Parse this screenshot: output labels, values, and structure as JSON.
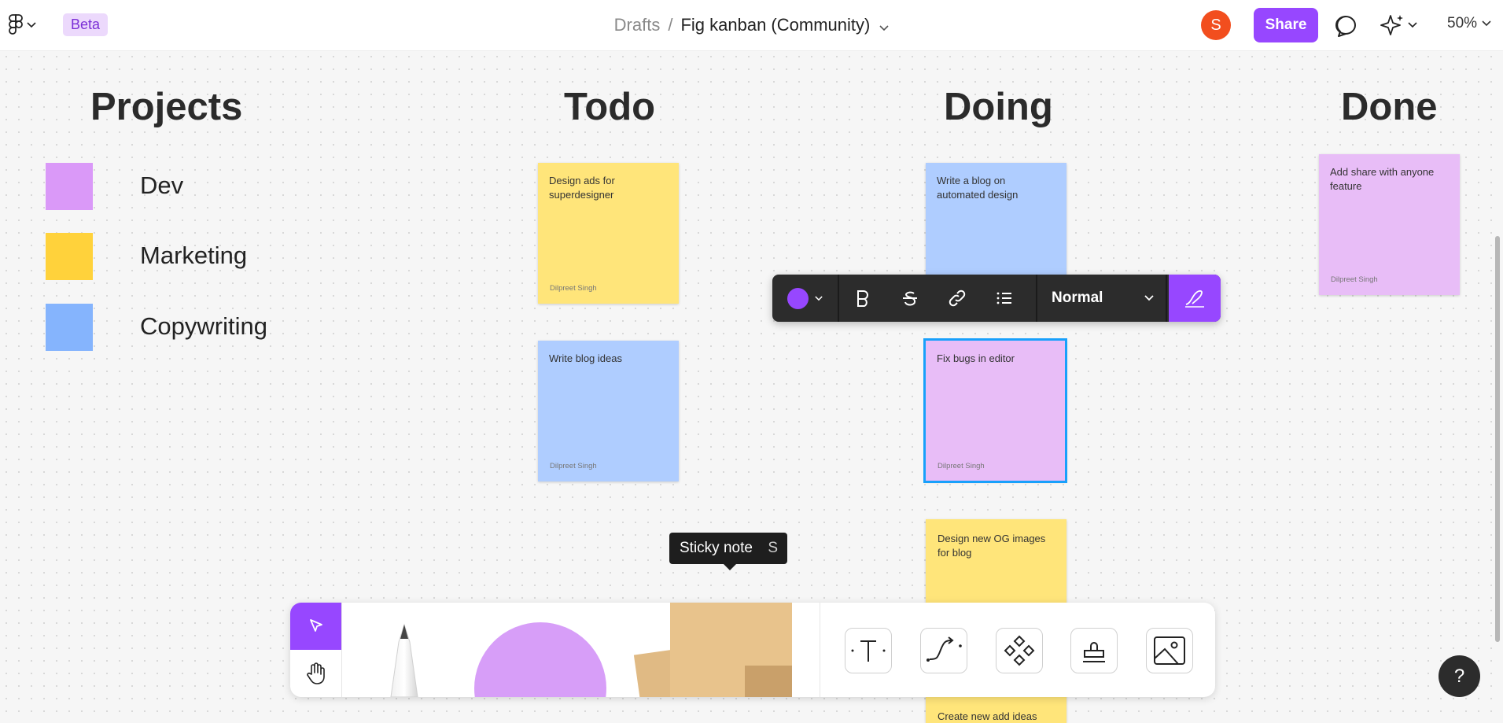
{
  "header": {
    "beta_label": "Beta",
    "breadcrumb_root": "Drafts",
    "breadcrumb_separator": "/",
    "file_name": "Fig kanban (Community)",
    "avatar_initial": "S",
    "share_label": "Share",
    "zoom_level": "50%"
  },
  "columns": {
    "projects": "Projects",
    "todo": "Todo",
    "doing": "Doing",
    "done": "Done"
  },
  "legend": [
    {
      "label": "Dev",
      "color": "#da99f8"
    },
    {
      "label": "Marketing",
      "color": "#ffd23b"
    },
    {
      "label": "Copywriting",
      "color": "#85b4fd"
    }
  ],
  "stickies": {
    "todo_1": {
      "text": "Design ads for superdesigner",
      "author": "Dilpreet Singh",
      "color": "#ffe57a"
    },
    "todo_2": {
      "text": "Write blog ideas",
      "author": "Dilpreet Singh",
      "color": "#afcdff"
    },
    "doing_1": {
      "text": "Write a blog on automated design",
      "color": "#afcdff"
    },
    "doing_2": {
      "text": "Fix bugs in editor",
      "author": "Dilpreet Singh",
      "color": "#e8bdf7"
    },
    "doing_3": {
      "text": "Design new OG images for blog",
      "color": "#ffe57a"
    },
    "doing_4": {
      "text": "Create new add ideas",
      "color": "#ffe57a"
    },
    "done_1": {
      "text": "Add share with anyone feature",
      "author": "Dilpreet Singh",
      "color": "#e8bdf7"
    }
  },
  "format_toolbar": {
    "color": "#9747ff",
    "text_style": "Normal",
    "icons": [
      "bold-icon",
      "strikethrough-icon",
      "link-icon",
      "bullet-list-icon",
      "pen-icon"
    ]
  },
  "tooltip": {
    "label": "Sticky note",
    "shortcut": "S"
  },
  "toolbar": {
    "tools": [
      "move-icon",
      "hand-icon",
      "marker-icon",
      "shape-icon",
      "sticky-note-icon",
      "text-icon",
      "connector-icon",
      "component-icon",
      "stamp-icon",
      "image-icon"
    ],
    "accent": "#9747ff"
  },
  "help_label": "?"
}
